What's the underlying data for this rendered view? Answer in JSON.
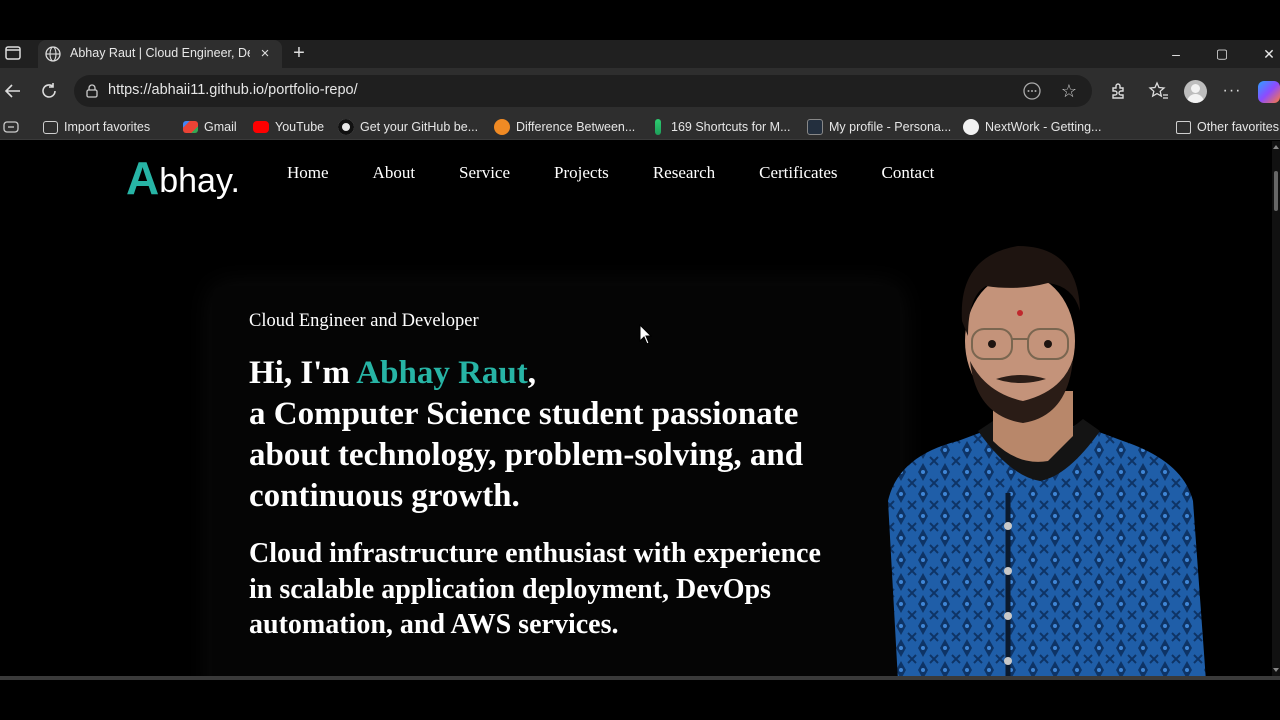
{
  "browser": {
    "tab": {
      "title": "Abhay Raut | Cloud Engineer, Dev",
      "close_icon": "×"
    },
    "new_tab_icon": "+",
    "window_controls": {
      "minimize": "–",
      "maximize": "▢",
      "close": "✕"
    },
    "address_url": "https://abhaii11.github.io/portfolio-repo/",
    "toolbar_icons": [
      "back-icon",
      "refresh-icon",
      "read-aloud-icon",
      "favorite-star-icon",
      "extensions-icon",
      "favorites-icon",
      "profile-avatar",
      "more-icon",
      "copilot-icon"
    ],
    "bookmarks": [
      {
        "label": "Import favorites",
        "icon": "import-icon",
        "color": "#cfcfcf"
      },
      {
        "label": "Gmail",
        "icon": "gmail-icon",
        "color": "#ea4335"
      },
      {
        "label": "YouTube",
        "icon": "youtube-icon",
        "color": "#ff0000"
      },
      {
        "label": "Get your GitHub be...",
        "icon": "github-icon",
        "color": "#e6e6e6"
      },
      {
        "label": "Difference Between...",
        "icon": "owl-icon",
        "color": "#f08a24"
      },
      {
        "label": "169 Shortcuts for M...",
        "icon": "bolt-icon",
        "color": "#2ecc71"
      },
      {
        "label": "My profile - Persona...",
        "icon": "aws-icon",
        "color": "#232f3e"
      },
      {
        "label": "NextWork - Getting...",
        "icon": "nextwork-icon",
        "color": "#f2f2f2"
      },
      {
        "label": "Other favorites",
        "icon": "folder-icon",
        "color": "#cfcfcf"
      }
    ]
  },
  "site": {
    "logo": {
      "first_letter": "A",
      "rest": "bhay."
    },
    "nav": [
      "Home",
      "About",
      "Service",
      "Projects",
      "Research",
      "Certificates",
      "Contact"
    ],
    "hero": {
      "subtitle": "Cloud Engineer and Developer",
      "greeting": "Hi, I'm ",
      "name": "Abhay Raut",
      "comma": ",",
      "headline_rest": "a Computer Science student passionate about technology, problem-solving, and continuous growth.",
      "description": "Cloud infrastructure enthusiast with experience in scalable application deployment, DevOps automation, and AWS services."
    },
    "accent_color": "#27b4a5"
  }
}
